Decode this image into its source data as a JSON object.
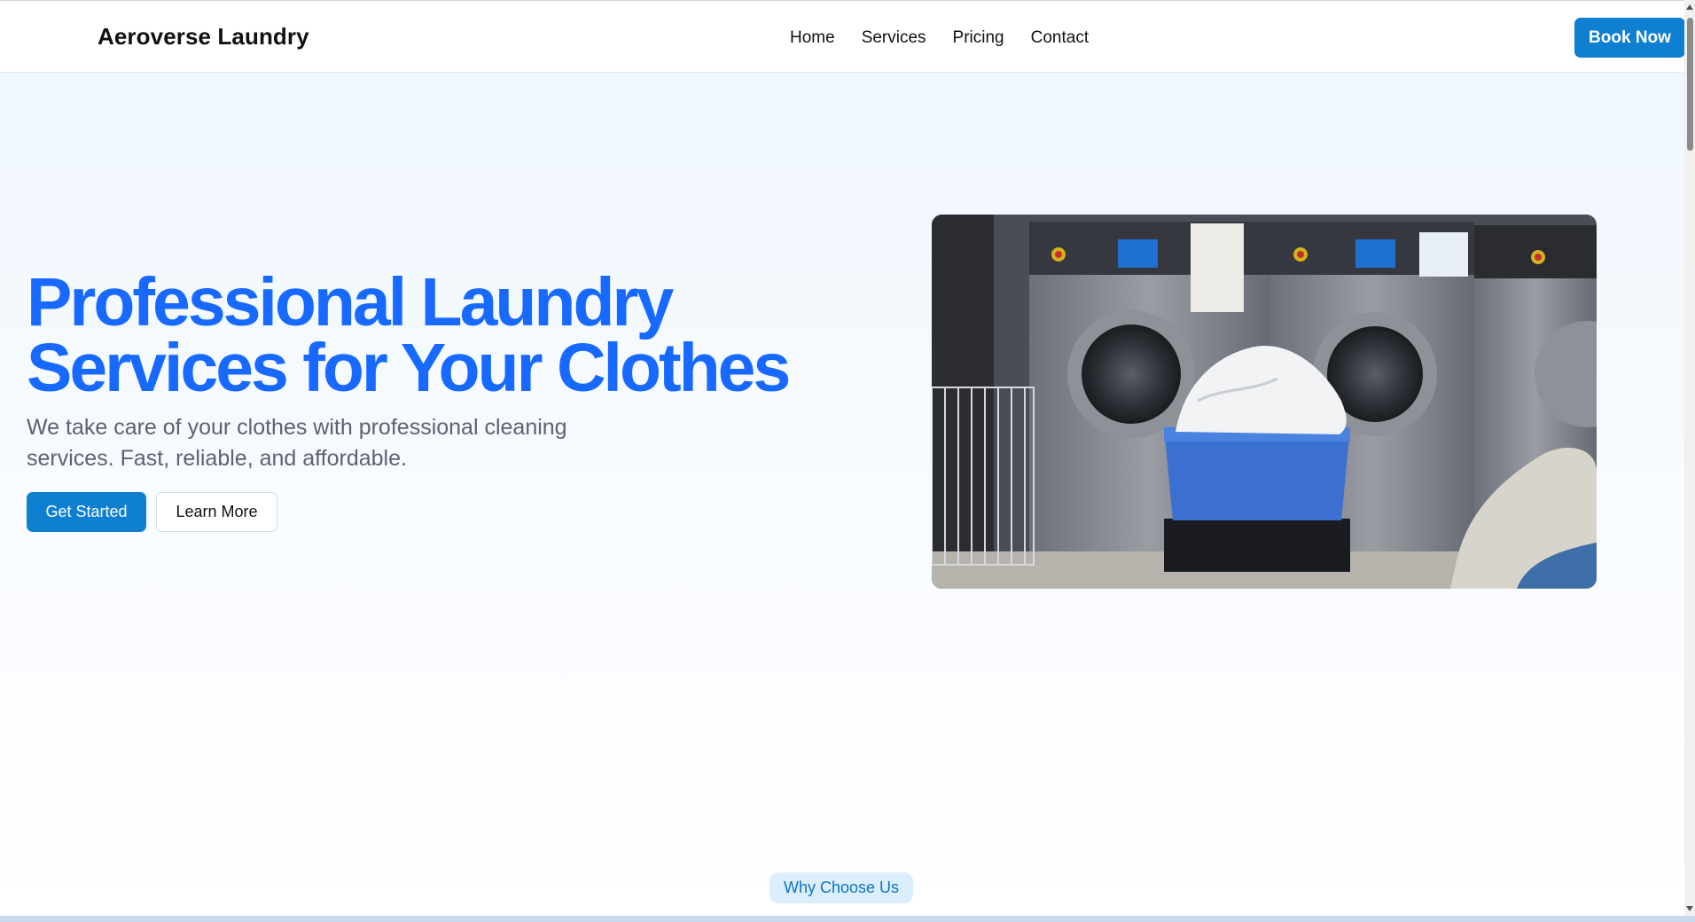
{
  "header": {
    "brand": "Aeroverse Laundry",
    "nav": [
      "Home",
      "Services",
      "Pricing",
      "Contact"
    ],
    "cta": "Book Now"
  },
  "hero": {
    "title_line1": "Professional Laundry",
    "title_line2": "Services for Your Clothes",
    "subtitle_line1": "We take care of your clothes with professional cleaning",
    "subtitle_line2": "services. Fast, reliable, and affordable.",
    "primary_button": "Get Started",
    "secondary_button": "Learn More",
    "image": "laundromat-washing-machines-photo"
  },
  "section_badge": "Why Choose Us",
  "colors": {
    "accent": "#1769ff",
    "button": "#0e7fd1",
    "badge_bg": "#dbeefb"
  }
}
